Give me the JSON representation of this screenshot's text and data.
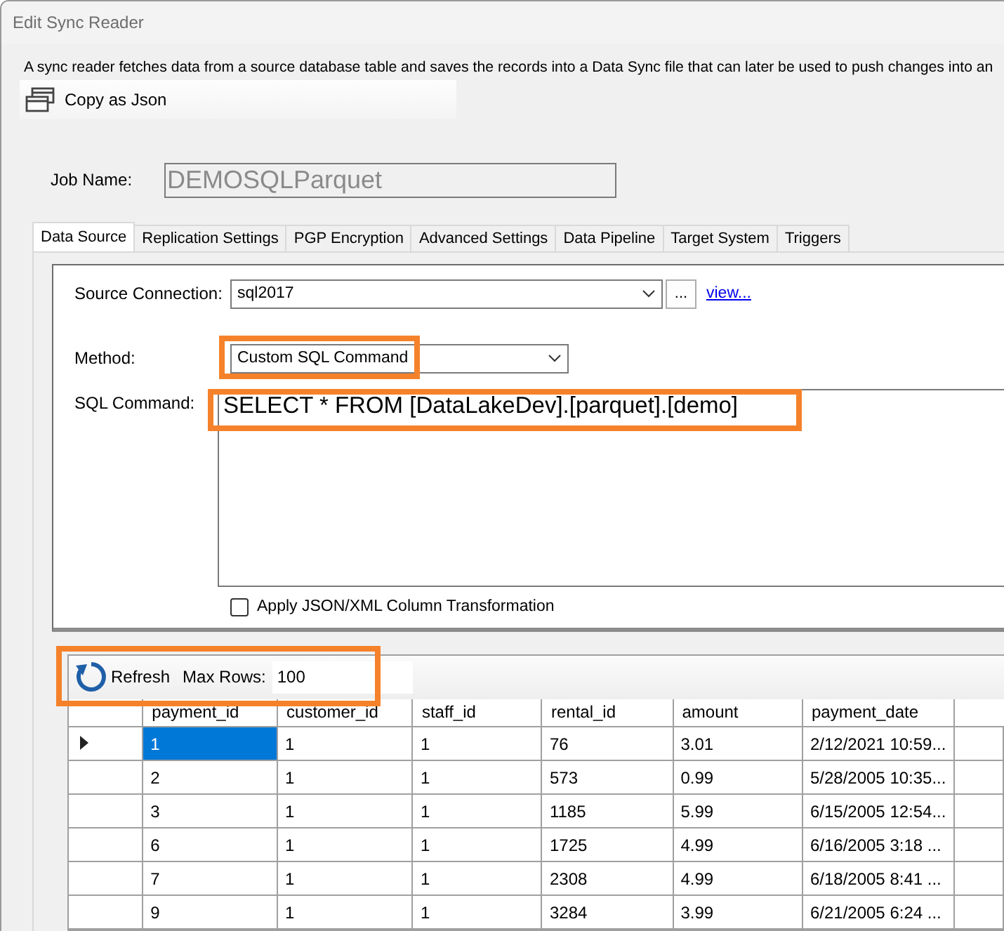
{
  "window": {
    "title": "Edit Sync Reader"
  },
  "description": "A sync reader fetches data from a source database table and saves the records into a Data Sync file that can later be used to push changes into an",
  "toolbar": {
    "copy_button": "Copy as Json"
  },
  "job_name": {
    "label": "Job Name:",
    "value": "DEMOSQLParquet",
    "disabled": true
  },
  "tabs": [
    {
      "label": "Data Source",
      "selected": true
    },
    {
      "label": "Replication Settings",
      "selected": false
    },
    {
      "label": "PGP Encryption",
      "selected": false
    },
    {
      "label": "Advanced Settings",
      "selected": false
    },
    {
      "label": "Data Pipeline",
      "selected": false
    },
    {
      "label": "Target System",
      "selected": false
    },
    {
      "label": "Triggers",
      "selected": false
    }
  ],
  "source_connection": {
    "label": "Source Connection:",
    "value": "sql2017",
    "browse_button": "...",
    "view_link": "view..."
  },
  "method": {
    "label": "Method:",
    "value": "Custom SQL Command",
    "highlighted": true
  },
  "sql_command": {
    "label": "SQL Command:",
    "value": "SELECT * FROM [DataLakeDev].[parquet].[demo]",
    "highlighted": true
  },
  "transform_checkbox": {
    "label": "Apply JSON/XML Column Transformation",
    "checked": false
  },
  "preview": {
    "refresh_button": "Refresh",
    "max_rows_label": "Max Rows:",
    "max_rows": "100",
    "highlighted": true
  },
  "table": {
    "columns": [
      "payment_id",
      "customer_id",
      "staff_id",
      "rental_id",
      "amount",
      "payment_date"
    ],
    "rows": [
      {
        "selected": true,
        "cells": [
          "1",
          "1",
          "1",
          "76",
          "3.01",
          "2/12/2021 10:59..."
        ]
      },
      {
        "selected": false,
        "cells": [
          "2",
          "1",
          "1",
          "573",
          "0.99",
          "5/28/2005 10:35..."
        ]
      },
      {
        "selected": false,
        "cells": [
          "3",
          "1",
          "1",
          "1185",
          "5.99",
          "6/15/2005 12:54..."
        ]
      },
      {
        "selected": false,
        "cells": [
          "6",
          "1",
          "1",
          "1725",
          "4.99",
          "6/16/2005 3:18 ..."
        ]
      },
      {
        "selected": false,
        "cells": [
          "7",
          "1",
          "1",
          "2308",
          "4.99",
          "6/18/2005 8:41 ..."
        ]
      },
      {
        "selected": false,
        "cells": [
          "9",
          "1",
          "1",
          "3284",
          "3.99",
          "6/21/2005 6:24 ..."
        ]
      }
    ]
  }
}
